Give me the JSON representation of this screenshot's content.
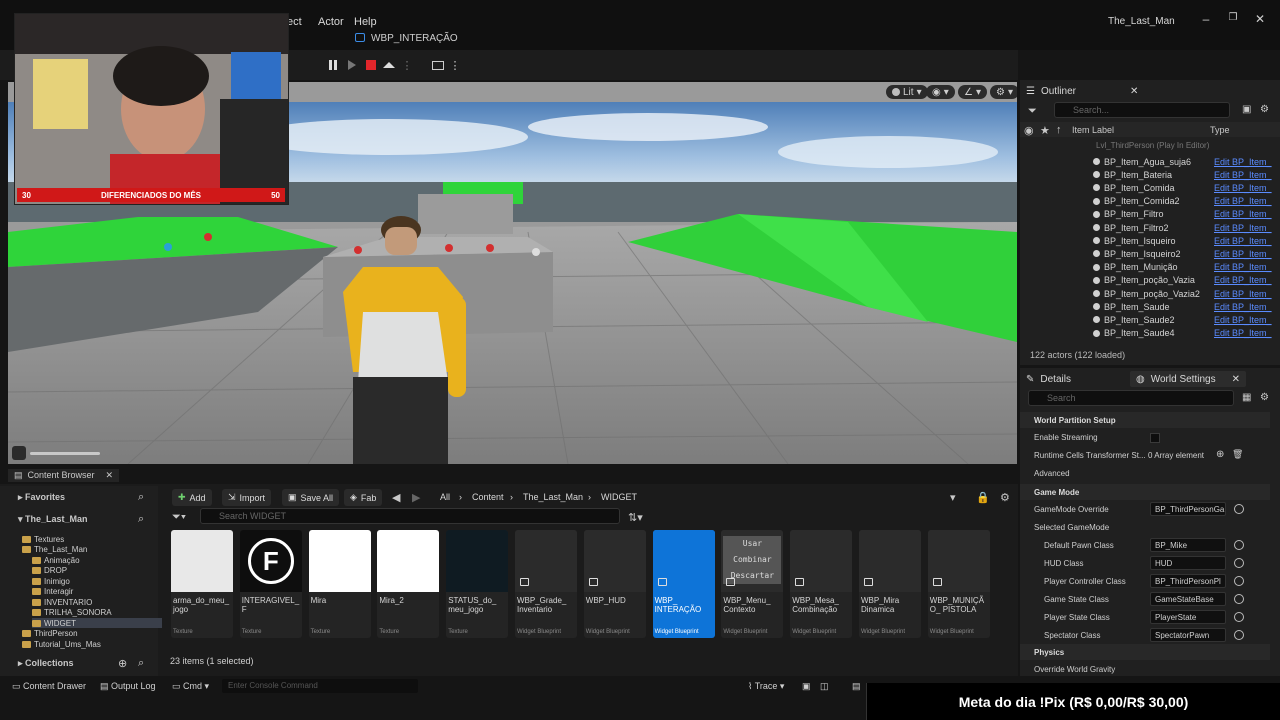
{
  "menu": {
    "items": [
      "ect",
      "Actor",
      "Help"
    ],
    "tab_label": "WBP_INTERAÇÃO",
    "app_title": "The_Last_Man"
  },
  "webcam": {
    "bar_left": "30",
    "bar_text": "DIFERENCIADOS DO MÊS",
    "bar_right": "50"
  },
  "viewport": {
    "lit_label": "Lit"
  },
  "outliner": {
    "tab": "Outliner",
    "search_placeholder": "Search...",
    "col_label": "Item Label",
    "col_type": "Type",
    "level": "Lvl_ThirdPerson (Play In Editor)",
    "rows": [
      {
        "name": "BP_Item_Agua_suja6",
        "type": "Edit BP_Item_"
      },
      {
        "name": "BP_Item_Bateria",
        "type": "Edit BP_Item_"
      },
      {
        "name": "BP_Item_Comida",
        "type": "Edit BP_Item_"
      },
      {
        "name": "BP_Item_Comida2",
        "type": "Edit BP_Item_"
      },
      {
        "name": "BP_Item_Filtro",
        "type": "Edit BP_Item_"
      },
      {
        "name": "BP_Item_Filtro2",
        "type": "Edit BP_Item_"
      },
      {
        "name": "BP_Item_Isqueiro",
        "type": "Edit BP_Item_"
      },
      {
        "name": "BP_Item_Isqueiro2",
        "type": "Edit BP_Item_"
      },
      {
        "name": "BP_Item_Munição",
        "type": "Edit BP_Item_"
      },
      {
        "name": "BP_Item_poção_Vazia",
        "type": "Edit BP_Item_"
      },
      {
        "name": "BP_Item_poção_Vazia2",
        "type": "Edit BP_Item_"
      },
      {
        "name": "BP_Item_Saude",
        "type": "Edit BP_Item_"
      },
      {
        "name": "BP_Item_Saude2",
        "type": "Edit BP_Item_"
      },
      {
        "name": "BP_Item_Saude4",
        "type": "Edit BP_Item_"
      }
    ],
    "actor_count": "122 actors (122 loaded)"
  },
  "details": {
    "tab_details": "Details",
    "tab_world": "World Settings",
    "search_placeholder": "Search",
    "sec_world_partition": "World Partition Setup",
    "enable_streaming": "Enable Streaming",
    "runtime_cells": "Runtime Cells Transformer St...",
    "runtime_cells_val": "0 Array element",
    "advanced": "Advanced",
    "sec_game_mode": "Game Mode",
    "gm_override": "GameMode Override",
    "gm_override_val": "BP_ThirdPersonGa",
    "selected_gm": "Selected GameMode",
    "rows": [
      {
        "label": "Default Pawn Class",
        "value": "BP_Mike"
      },
      {
        "label": "HUD Class",
        "value": "HUD"
      },
      {
        "label": "Player Controller Class",
        "value": "BP_ThirdPersonPl"
      },
      {
        "label": "Game State Class",
        "value": "GameStateBase"
      },
      {
        "label": "Player State Class",
        "value": "PlayerState"
      },
      {
        "label": "Spectator Class",
        "value": "SpectatorPawn"
      }
    ],
    "sec_physics": "Physics",
    "override_gravity": "Override World Gravity"
  },
  "content_browser": {
    "tab": "Content Browser",
    "favorites": "Favorites",
    "project": "The_Last_Man",
    "add": "Add",
    "import": "Import",
    "save_all": "Save All",
    "fab": "Fab",
    "breadcrumb": [
      "All",
      "Content",
      "The_Last_Man",
      "WIDGET"
    ],
    "search_placeholder": "Search WIDGET",
    "tree": [
      "Textures",
      "The_Last_Man",
      "Animação",
      "DROP",
      "Inimigo",
      "Interagir",
      "INVENTARIO",
      "TRILHA_SONORA",
      "WIDGET",
      "ThirdPerson",
      "Tutorial_Ums_Mas"
    ],
    "collections": "Collections",
    "items_count": "23 items (1 selected)",
    "assets": [
      {
        "name": "arma_do_meu_ jogo",
        "type": "Texture"
      },
      {
        "name": "INTERAGIVEL_F",
        "type": "Texture"
      },
      {
        "name": "Mira",
        "type": "Texture"
      },
      {
        "name": "Mira_2",
        "type": "Texture"
      },
      {
        "name": "STATUS_do_ meu_jogo",
        "type": "Texture"
      },
      {
        "name": "WBP_Grade_ Inventario",
        "type": "Widget Blueprint"
      },
      {
        "name": "WBP_HUD",
        "type": "Widget Blueprint"
      },
      {
        "name": "WBP_ INTERAÇÃO",
        "type": "Widget Blueprint"
      },
      {
        "name": "WBP_Menu_ Contexto",
        "type": "Widget Blueprint"
      },
      {
        "name": "WBP_Mesa_ Combinação",
        "type": "Widget Blueprint"
      },
      {
        "name": "WBP_Mira Dinamica",
        "type": "Widget Blueprint"
      },
      {
        "name": "WBP_MUNIÇÃO_ PISTOLA",
        "type": "Widget Blueprint"
      }
    ],
    "menu_preview": [
      "Usar",
      "Combinar",
      "Descartar"
    ],
    "logo_letter": "F"
  },
  "statusbar": {
    "content_drawer": "Content Drawer",
    "output_log": "Output Log",
    "cmd": "Cmd",
    "console_placeholder": "Enter Console Command",
    "trace": "Trace"
  },
  "overlay": {
    "meta": "Meta do dia !Pix (R$ 0,00/R$ 30,00)"
  }
}
